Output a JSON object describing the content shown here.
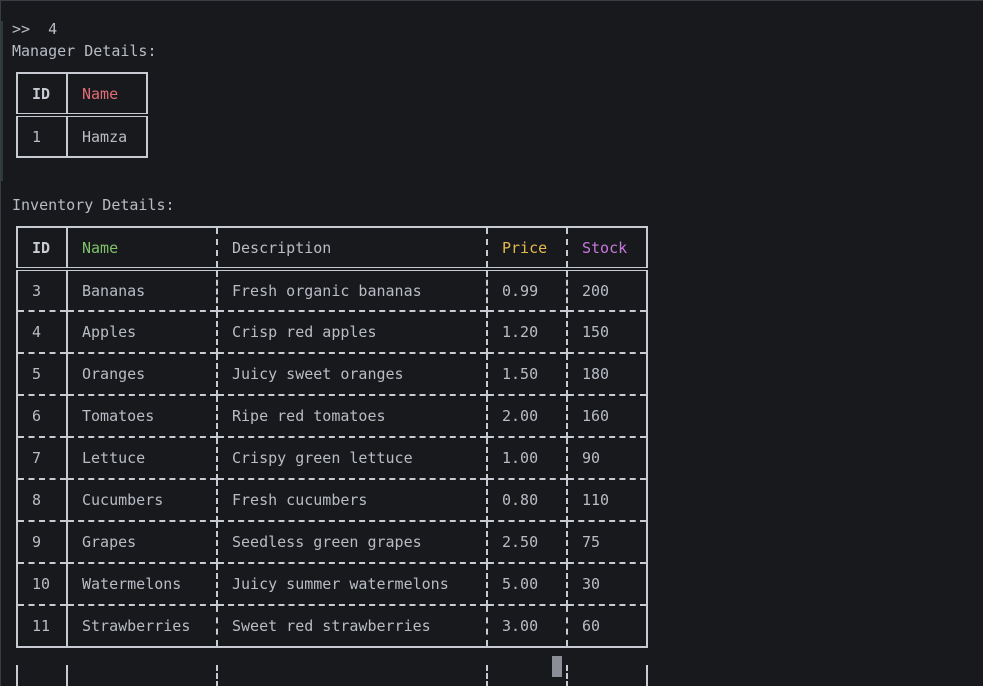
{
  "terminal": {
    "prompt": ">>  4",
    "manager_heading": "Manager Details:",
    "inventory_heading": "Inventory Details:"
  },
  "manager_table": {
    "headers": {
      "id": "ID",
      "name": "Name"
    },
    "rows": [
      {
        "id": "1",
        "name": "Hamza"
      }
    ]
  },
  "inventory_table": {
    "headers": {
      "id": "ID",
      "name": "Name",
      "description": "Description",
      "price": "Price",
      "stock": "Stock"
    },
    "rows": [
      {
        "id": "3",
        "name": "Bananas",
        "description": "Fresh organic bananas",
        "price": "0.99",
        "stock": "200"
      },
      {
        "id": "4",
        "name": "Apples",
        "description": "Crisp red apples",
        "price": "1.20",
        "stock": "150"
      },
      {
        "id": "5",
        "name": "Oranges",
        "description": "Juicy sweet oranges",
        "price": "1.50",
        "stock": "180"
      },
      {
        "id": "6",
        "name": "Tomatoes",
        "description": "Ripe red tomatoes",
        "price": "2.00",
        "stock": "160"
      },
      {
        "id": "7",
        "name": "Lettuce",
        "description": "Crispy green lettuce",
        "price": "1.00",
        "stock": "90"
      },
      {
        "id": "8",
        "name": "Cucumbers",
        "description": "Fresh cucumbers",
        "price": "0.80",
        "stock": "110"
      },
      {
        "id": "9",
        "name": "Grapes",
        "description": "Seedless green grapes",
        "price": "2.50",
        "stock": "75"
      },
      {
        "id": "10",
        "name": "Watermelons",
        "description": "Juicy summer watermelons",
        "price": "5.00",
        "stock": "30"
      },
      {
        "id": "11",
        "name": "Strawberries",
        "description": "Sweet red strawberries",
        "price": "3.00",
        "stock": "60"
      }
    ]
  },
  "colors": {
    "background": "#18191d",
    "text": "#b9bcc4",
    "border": "#c8cbd2",
    "manager_name_header": "#e06c75",
    "inventory_name_header": "#7ec16a",
    "price_header": "#e5b94e",
    "stock_header": "#c678dd"
  }
}
